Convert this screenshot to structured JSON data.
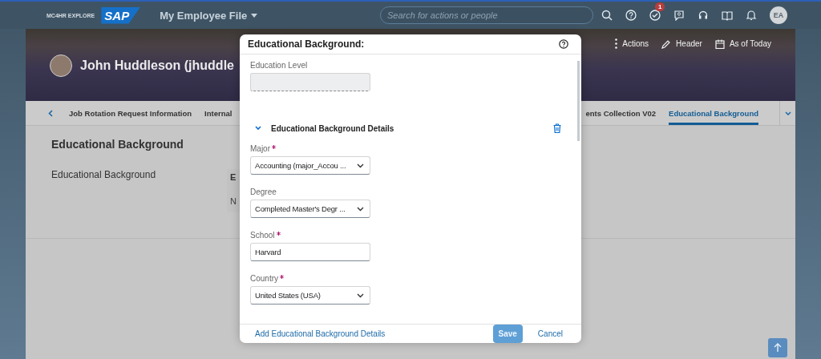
{
  "shell": {
    "brand_text": "MC4HR EXPLORE",
    "logo_text": "SAP",
    "app_title": "My Employee File",
    "search": {
      "placeholder": "Search for actions or people"
    },
    "task_badge": "1",
    "user_initials": "EA"
  },
  "profile": {
    "name": "John Huddleson (jhuddle",
    "actions": [
      "Actions",
      "Header",
      "As of Today"
    ]
  },
  "tabs_left": [
    {
      "label": "Job Rotation Request Information",
      "selected": false
    },
    {
      "label": "Internal",
      "selected": false
    }
  ],
  "tabs_right": [
    {
      "label": "ents Collection V02",
      "selected": false
    },
    {
      "label": "Educational Background",
      "selected": true
    }
  ],
  "section": {
    "title": "Educational Background",
    "label": "Educational Background",
    "card_header": "E",
    "card_cell": "N"
  },
  "dialog": {
    "title": "Educational Background:",
    "fields": [
      {
        "kind": "readonly",
        "label": "Education Level",
        "required": false
      },
      {
        "kind": "group",
        "label": "Educational Background Details",
        "expanded": true
      },
      {
        "kind": "select",
        "label": "Major",
        "required": true,
        "value": "Accounting (major_Accou ..."
      },
      {
        "kind": "select",
        "label": "Degree",
        "required": false,
        "value": "Completed Master's Degr ..."
      },
      {
        "kind": "input",
        "label": "School",
        "required": true,
        "value": "Harvard"
      },
      {
        "kind": "select",
        "label": "Country",
        "required": true,
        "value": "United States (USA)"
      }
    ],
    "add_link": "Add Educational Background Details",
    "buttons": [
      {
        "label": "Save",
        "kind": "primary",
        "disabled": true
      },
      {
        "label": "Cancel",
        "kind": "transparent",
        "disabled": false
      }
    ]
  }
}
